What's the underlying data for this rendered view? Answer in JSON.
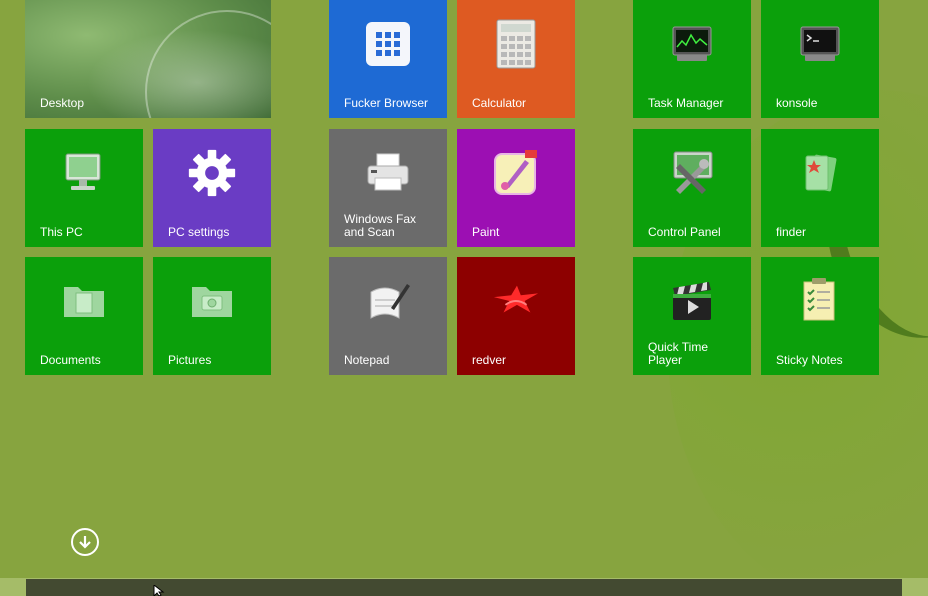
{
  "colors": {
    "background": "#87a43f",
    "green_tile": "#0ba00b",
    "blue_tile": "#1e6ad4",
    "orange_tile": "#de5a22",
    "purple_tile": "#6a3cc4",
    "gray_tile": "#6b6b6b",
    "magenta_tile": "#9c0fb3",
    "red_tile": "#8d0000"
  },
  "tiles": {
    "desktop": "Desktop",
    "this_pc": "This PC",
    "pc_settings": "PC settings",
    "documents": "Documents",
    "pictures": "Pictures",
    "browser": "Fucker Browser",
    "calculator": "Calculator",
    "fax_scan": "Windows Fax\nand Scan",
    "paint": "Paint",
    "notepad": "Notepad",
    "redver": "redver",
    "task_manager": "Task Manager",
    "konsole": "konsole",
    "control_panel": "Control Panel",
    "finder": "finder",
    "quicktime": "Quick Time\nPlayer",
    "sticky_notes": "Sticky Notes"
  },
  "icons": {
    "desktop": "desktop-wallpaper",
    "this_pc": "computer-monitor-icon",
    "pc_settings": "gear-icon",
    "documents": "folder-document-icon",
    "pictures": "folder-camera-icon",
    "browser": "app-grid-icon",
    "calculator": "calculator-icon",
    "fax_scan": "printer-icon",
    "paint": "paint-brush-icon",
    "notepad": "notepad-pen-icon",
    "redver": "red-emblem-icon",
    "task_manager": "monitor-graph-icon",
    "konsole": "terminal-icon",
    "control_panel": "tools-icon",
    "finder": "folder-star-icon",
    "quicktime": "clapperboard-icon",
    "sticky_notes": "checklist-icon",
    "scroll_down": "arrow-down-circle-icon"
  }
}
